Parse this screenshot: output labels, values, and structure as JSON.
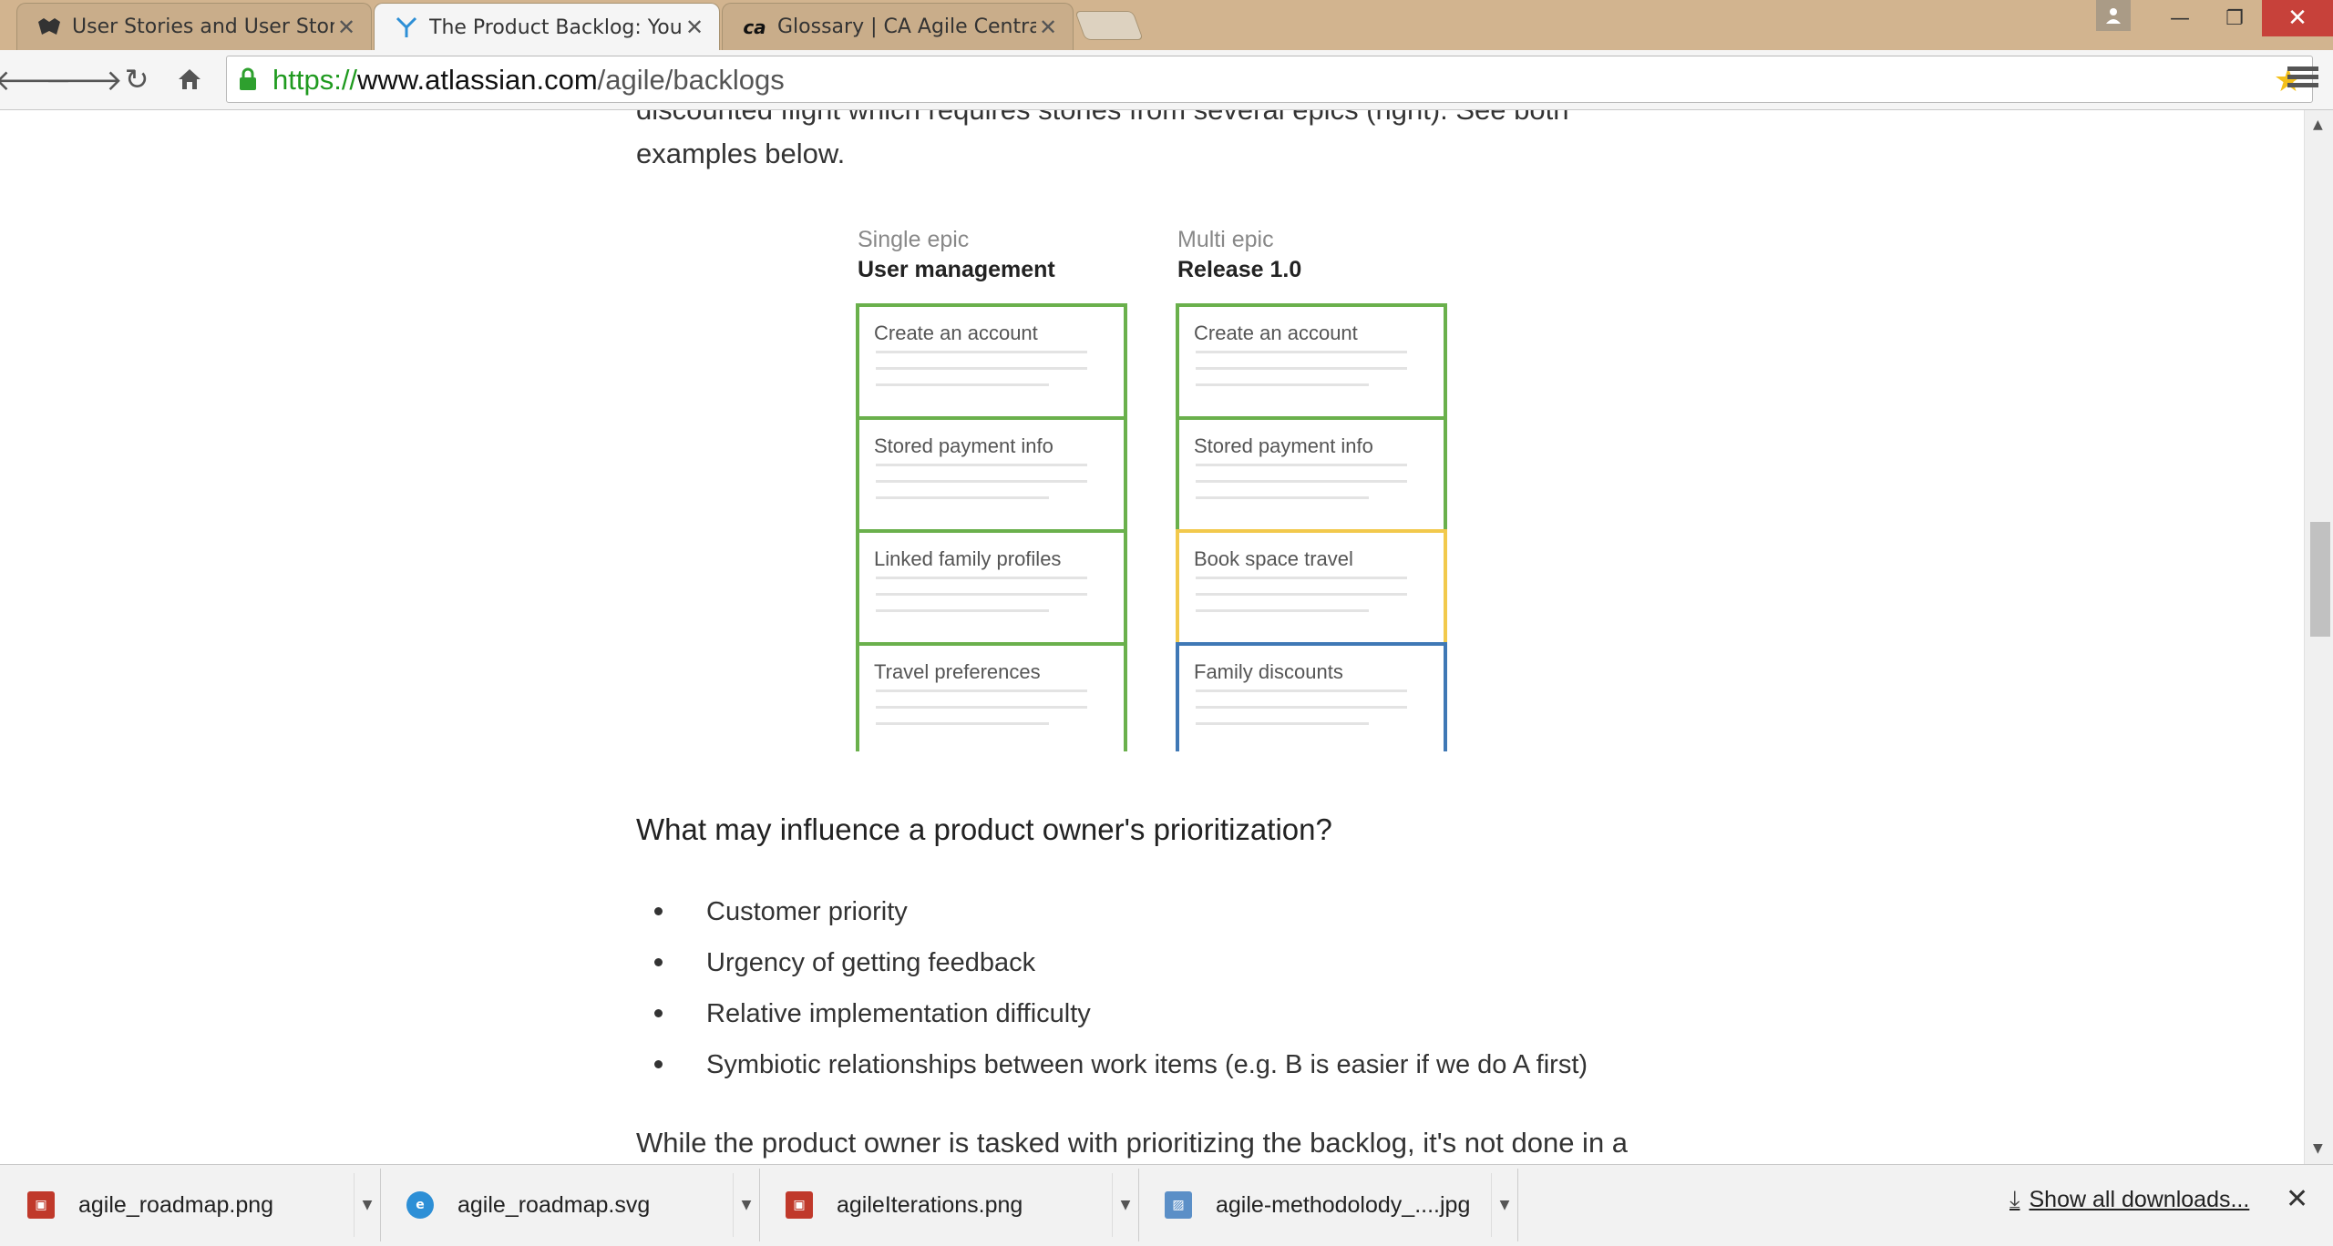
{
  "tabs": [
    {
      "title": "User Stories and User Stor",
      "icon": "wolf-icon",
      "active": false
    },
    {
      "title": "The Product Backlog: Your",
      "icon": "atlassian-icon",
      "active": true
    },
    {
      "title": "Glossary | CA Agile Centra",
      "icon": "ca-icon",
      "active": false
    }
  ],
  "address": {
    "scheme": "https://",
    "host": "www.atlassian.com",
    "path": "/agile/backlogs"
  },
  "article": {
    "intro_line1": "discounted flight which requires stories from several epics (right). See both",
    "intro_line2": "examples below.",
    "question": "What may influence a product owner's prioritization?",
    "bullets": [
      "Customer priority",
      "Urgency of getting feedback",
      "Relative implementation difficulty",
      "Symbiotic relationships between work items (e.g. B is easier if we do A first)"
    ],
    "closing": "While the product owner is tasked with prioritizing the backlog, it's not done in a"
  },
  "diagram": {
    "single": {
      "subtitle": "Single epic",
      "title": "User management",
      "cards": [
        {
          "label": "Create an account",
          "color": "#6ab04c"
        },
        {
          "label": "Stored payment info",
          "color": "#6ab04c"
        },
        {
          "label": "Linked family profiles",
          "color": "#6ab04c"
        },
        {
          "label": "Travel preferences",
          "color": "#6ab04c"
        }
      ]
    },
    "multi": {
      "subtitle": "Multi epic",
      "title": "Release 1.0",
      "cards": [
        {
          "label": "Create an account",
          "color": "#6ab04c"
        },
        {
          "label": "Stored payment info",
          "color": "#6ab04c"
        },
        {
          "label": "Book space travel",
          "color": "#f2c94c"
        },
        {
          "label": "Family discounts",
          "color": "#3f78b5"
        }
      ]
    }
  },
  "downloads": {
    "items": [
      {
        "name": "agile_roadmap.png",
        "icon": "image-file-icon"
      },
      {
        "name": "agile_roadmap.svg",
        "icon": "ie-file-icon"
      },
      {
        "name": "agileIterations.png",
        "icon": "image-file-icon"
      },
      {
        "name": "agile-methodolody_....jpg",
        "icon": "picture-file-icon"
      }
    ],
    "show_all": "Show all downloads..."
  }
}
